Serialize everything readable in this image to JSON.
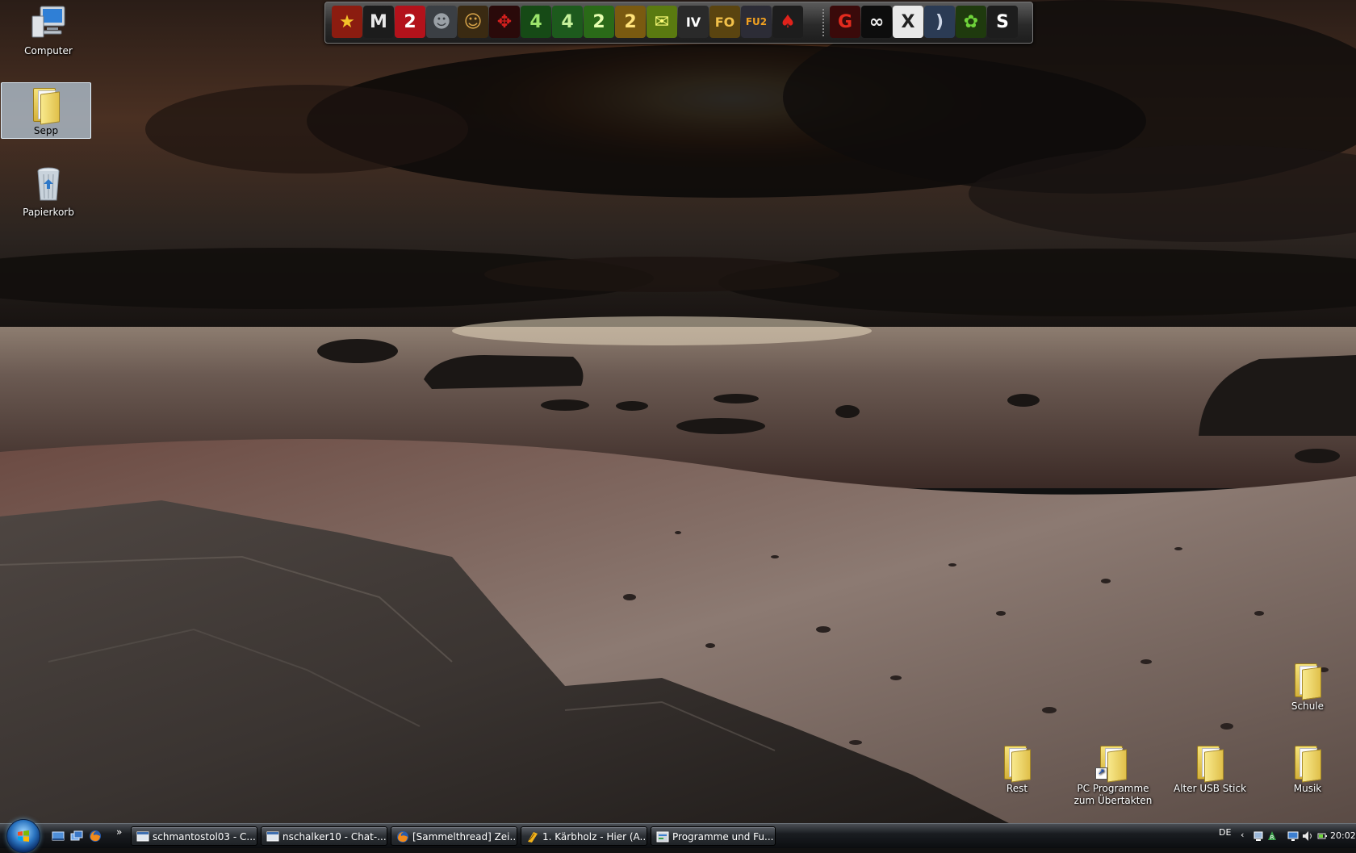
{
  "desktop": {
    "icons": [
      {
        "label": "Computer",
        "icon": "computer-icon"
      },
      {
        "label": "Sepp",
        "icon": "folder-icon",
        "selected": true
      },
      {
        "label": "Papierkorb",
        "icon": "recycle-bin-icon"
      },
      {
        "label": "Schule",
        "icon": "folder-icon"
      },
      {
        "label": "Rest",
        "icon": "folder-icon"
      },
      {
        "label": "PC Programme zum Übertakten",
        "icon": "folder-shortcut-icon"
      },
      {
        "label": "Alter USB Stick",
        "icon": "folder-icon"
      },
      {
        "label": "Musik",
        "icon": "folder-icon"
      }
    ]
  },
  "dock": {
    "items": [
      {
        "name": "star-game-icon",
        "text": "★",
        "bg": "#8b1c10",
        "fg": "#f3c22a"
      },
      {
        "name": "mafia2-m-icon",
        "text": "M",
        "bg": "#1c1c1c",
        "fg": "#e8e8e8"
      },
      {
        "name": "mafia2-2-icon",
        "text": "2",
        "bg": "#b3121b",
        "fg": "#ffffff"
      },
      {
        "name": "soldier-game-icon",
        "text": "☻",
        "bg": "#3b3f44",
        "fg": "#9aa0a6"
      },
      {
        "name": "face-game-icon",
        "text": "☺",
        "bg": "#3a2a12",
        "fg": "#d9a54a"
      },
      {
        "name": "red-emblem-icon",
        "text": "✥",
        "bg": "#2a0a0a",
        "fg": "#d4201e"
      },
      {
        "name": "l4d-1-icon",
        "text": "4",
        "bg": "#164a16",
        "fg": "#9be36b"
      },
      {
        "name": "l4d-2-icon",
        "text": "4",
        "bg": "#1d5a1d",
        "fg": "#c5f09a"
      },
      {
        "name": "l4d2-green-icon",
        "text": "2",
        "bg": "#2a6a18",
        "fg": "#e6ffb0"
      },
      {
        "name": "l4d2-gold-icon",
        "text": "2",
        "bg": "#7a5a10",
        "fg": "#ffe27a"
      },
      {
        "name": "chat-bubble-icon",
        "text": "✉",
        "bg": "#5a7a10",
        "fg": "#ffff7a"
      },
      {
        "name": "gta-iv-icon",
        "text": "IV",
        "bg": "#2a2a2a",
        "fg": "#ffffff"
      },
      {
        "name": "flatout-icon",
        "text": "FO",
        "bg": "#5a4410",
        "fg": "#f2c14a"
      },
      {
        "name": "fuel-icon",
        "text": "FU2",
        "bg": "#2c2c36",
        "fg": "#f0a020"
      },
      {
        "name": "pokerstars-icon",
        "text": "♠",
        "bg": "#1d1d1d",
        "fg": "#e0221b"
      },
      {
        "name": "garena-icon",
        "text": "G",
        "bg": "#3a0a0a",
        "fg": "#e22b1e"
      },
      {
        "name": "steam-icon",
        "text": "∞",
        "bg": "#0d0d0d",
        "fg": "#f2f2f2"
      },
      {
        "name": "xfire-icon",
        "text": "X",
        "bg": "#e9e9e9",
        "fg": "#222222"
      },
      {
        "name": "teamspeak-icon",
        "text": ")",
        "bg": "#2b3b54",
        "fg": "#cfd8e8"
      },
      {
        "name": "icq-icon",
        "text": "✿",
        "bg": "#1f3a0e",
        "fg": "#6fd43a"
      },
      {
        "name": "skype-icon",
        "text": "S",
        "bg": "#1d1d1d",
        "fg": "#ffffff"
      }
    ]
  },
  "taskbar": {
    "quick_launch": [
      "show-desktop-icon",
      "switch-windows-icon",
      "firefox-icon"
    ],
    "overflow": "»",
    "tasks": [
      {
        "label": "schmantostol03 - C...",
        "icon": "chat-window-icon"
      },
      {
        "label": "nschalker10 - Chat-...",
        "icon": "chat-window-icon"
      },
      {
        "label": "[Sammelthread] Zei...",
        "icon": "firefox-icon"
      },
      {
        "label": "1. Kärbholz - Hier (A...",
        "icon": "music-player-icon"
      },
      {
        "label": "Programme und Fu...",
        "icon": "control-panel-icon"
      }
    ],
    "tray": {
      "language": "DE",
      "clock": "20:02"
    }
  },
  "colors": {
    "taskbar_accent": "#1a1d21",
    "selection": "#c8e1f5"
  }
}
